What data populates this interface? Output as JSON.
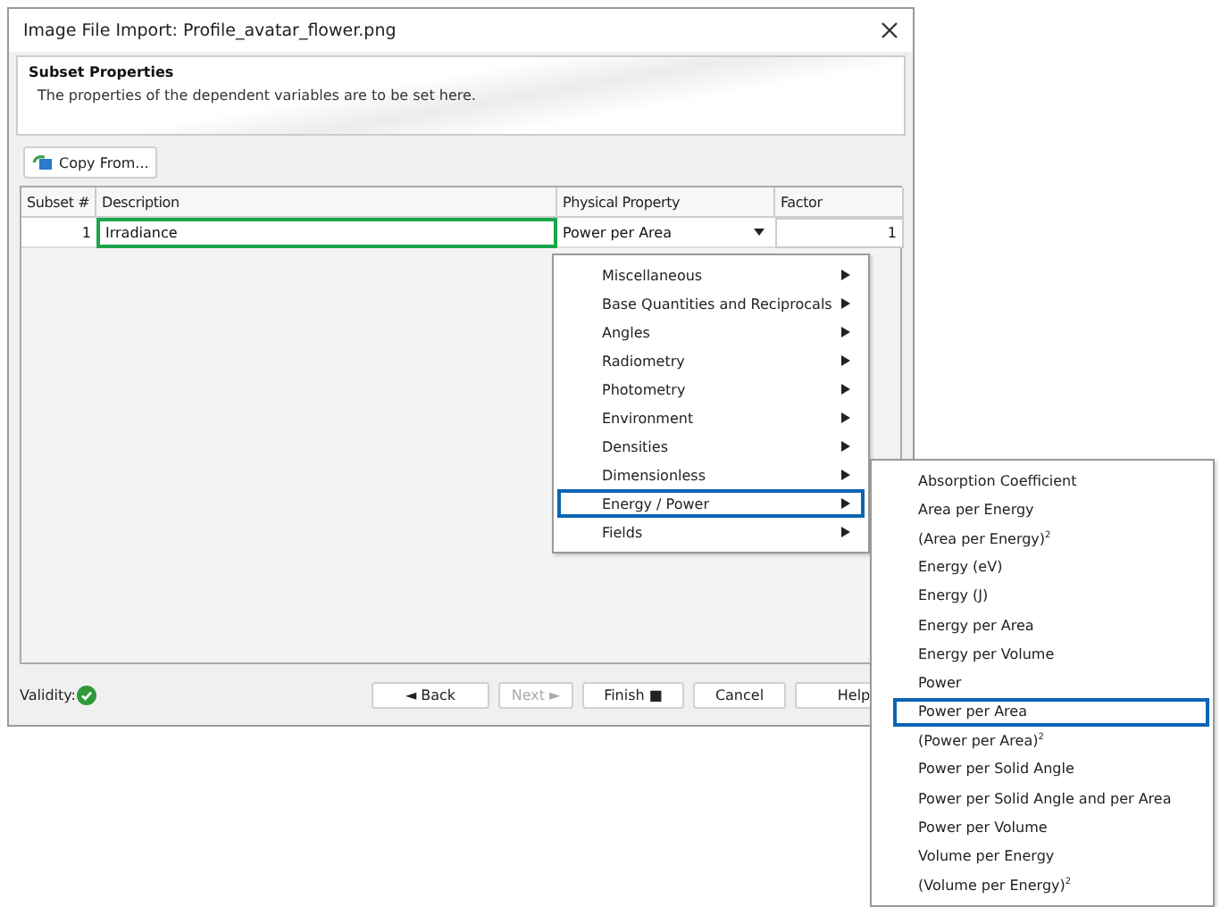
{
  "window": {
    "title": "Image File Import: Profile_avatar_flower.png"
  },
  "header": {
    "title": "Subset Properties",
    "subtitle": "The properties of the dependent variables are to be set here."
  },
  "toolbar": {
    "copy_button": "Copy From..."
  },
  "table": {
    "columns": [
      "Subset #",
      "Description",
      "Physical Property",
      "Factor"
    ],
    "rows": [
      {
        "subset": "1",
        "description": "Irradiance",
        "physical_property": "Power per Area",
        "factor": "1",
        "selected": true
      }
    ]
  },
  "menu": {
    "items": [
      {
        "label": "Miscellaneous",
        "selected": false
      },
      {
        "label": "Base Quantities and Reciprocals",
        "selected": false
      },
      {
        "label": "Angles",
        "selected": false
      },
      {
        "label": "Radiometry",
        "selected": false
      },
      {
        "label": "Photometry",
        "selected": false
      },
      {
        "label": "Environment",
        "selected": false
      },
      {
        "label": "Densities",
        "selected": false
      },
      {
        "label": "Dimensionless",
        "selected": false
      },
      {
        "label": "Energy / Power",
        "selected": true
      },
      {
        "label": "Fields",
        "selected": false
      }
    ]
  },
  "submenu": {
    "items": [
      {
        "label": "Absorption Coefficient",
        "selected": false
      },
      {
        "label": "Area per Energy",
        "selected": false
      },
      {
        "label": "(Area per Energy)$^{2}$",
        "selected": false
      },
      {
        "label": "Energy (eV)",
        "selected": false
      },
      {
        "label": "Energy (J)",
        "selected": false
      },
      {
        "label": "Energy per Area",
        "selected": false
      },
      {
        "label": "Energy per Volume",
        "selected": false
      },
      {
        "label": "Power",
        "selected": false
      },
      {
        "label": "Power per Area",
        "selected": true
      },
      {
        "label": "(Power per Area)$^{2}$",
        "selected": false
      },
      {
        "label": "Power per Solid Angle",
        "selected": false
      },
      {
        "label": "Power per Solid Angle and per Area",
        "selected": false
      },
      {
        "label": "Power per Volume",
        "selected": false
      },
      {
        "label": "Volume per Energy",
        "selected": false
      },
      {
        "label": "(Volume per Energy)$^{2}$",
        "selected": false
      }
    ]
  },
  "footer": {
    "validity_label": "Validity:",
    "valid": true,
    "buttons": [
      {
        "label": "◄ Back",
        "disabled": false
      },
      {
        "label": "Next ►",
        "disabled": true
      },
      {
        "label": "Finish ■",
        "disabled": false
      },
      {
        "label": "Cancel",
        "disabled": false
      },
      {
        "label": "Help",
        "disabled": false
      }
    ]
  }
}
